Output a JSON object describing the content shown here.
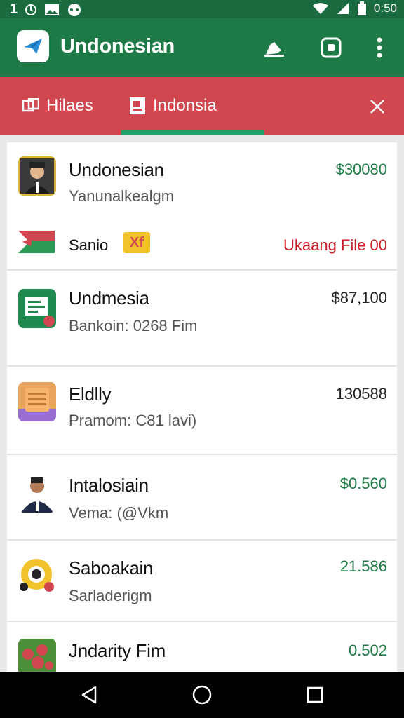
{
  "status_bar": {
    "left_text": "1",
    "time": "0:50",
    "icons": [
      "clock-icon",
      "photo-icon",
      "chat-icon",
      "wifi-icon",
      "signal-icon",
      "battery-icon"
    ]
  },
  "app_bar": {
    "title": "Undonesian",
    "actions": [
      "edit-icon",
      "screenshot-icon",
      "more-vert-icon"
    ]
  },
  "tabs": [
    {
      "label": "Hilaes",
      "icon": "images-icon"
    },
    {
      "label": "Indonsia",
      "icon": "document-icon",
      "selected": true
    }
  ],
  "list": {
    "items": [
      {
        "title": "Undonesian",
        "subtitle": "Yanunalkealgm",
        "amount": "$30080",
        "amount_color": "#1f7a45",
        "extra": {
          "label": "Sanio",
          "badge": "Xf",
          "warning": "Ukaang File 00"
        }
      },
      {
        "title": "Undmesia",
        "subtitle": "Bankoin: 0268 Fim",
        "amount": "$87,100",
        "amount_color": "#222222"
      },
      {
        "title": "Eldlly",
        "subtitle": "Pramom: C81 lavi)",
        "amount": "130588",
        "amount_color": "#222222"
      },
      {
        "title": "Intalosiain",
        "subtitle": "Vema: (@Vkm",
        "amount": "$0.560",
        "amount_color": "#1f7a45"
      },
      {
        "title": "Saboakain",
        "subtitle": "Sarladerigm",
        "amount": "21.586",
        "amount_color": "#1f7a45"
      },
      {
        "title": "Jndarity Fim",
        "subtitle": "",
        "amount": "0.502",
        "amount_color": "#1f7a45"
      }
    ]
  },
  "nav_bar": [
    "back-icon",
    "home-icon",
    "recents-icon"
  ],
  "colors": {
    "status_bar": "#1a6b3f",
    "app_bar": "#1d7a47",
    "tab_bar": "#d0474f",
    "indicator": "#22a06b",
    "warning_text": "#cc1f2a"
  }
}
